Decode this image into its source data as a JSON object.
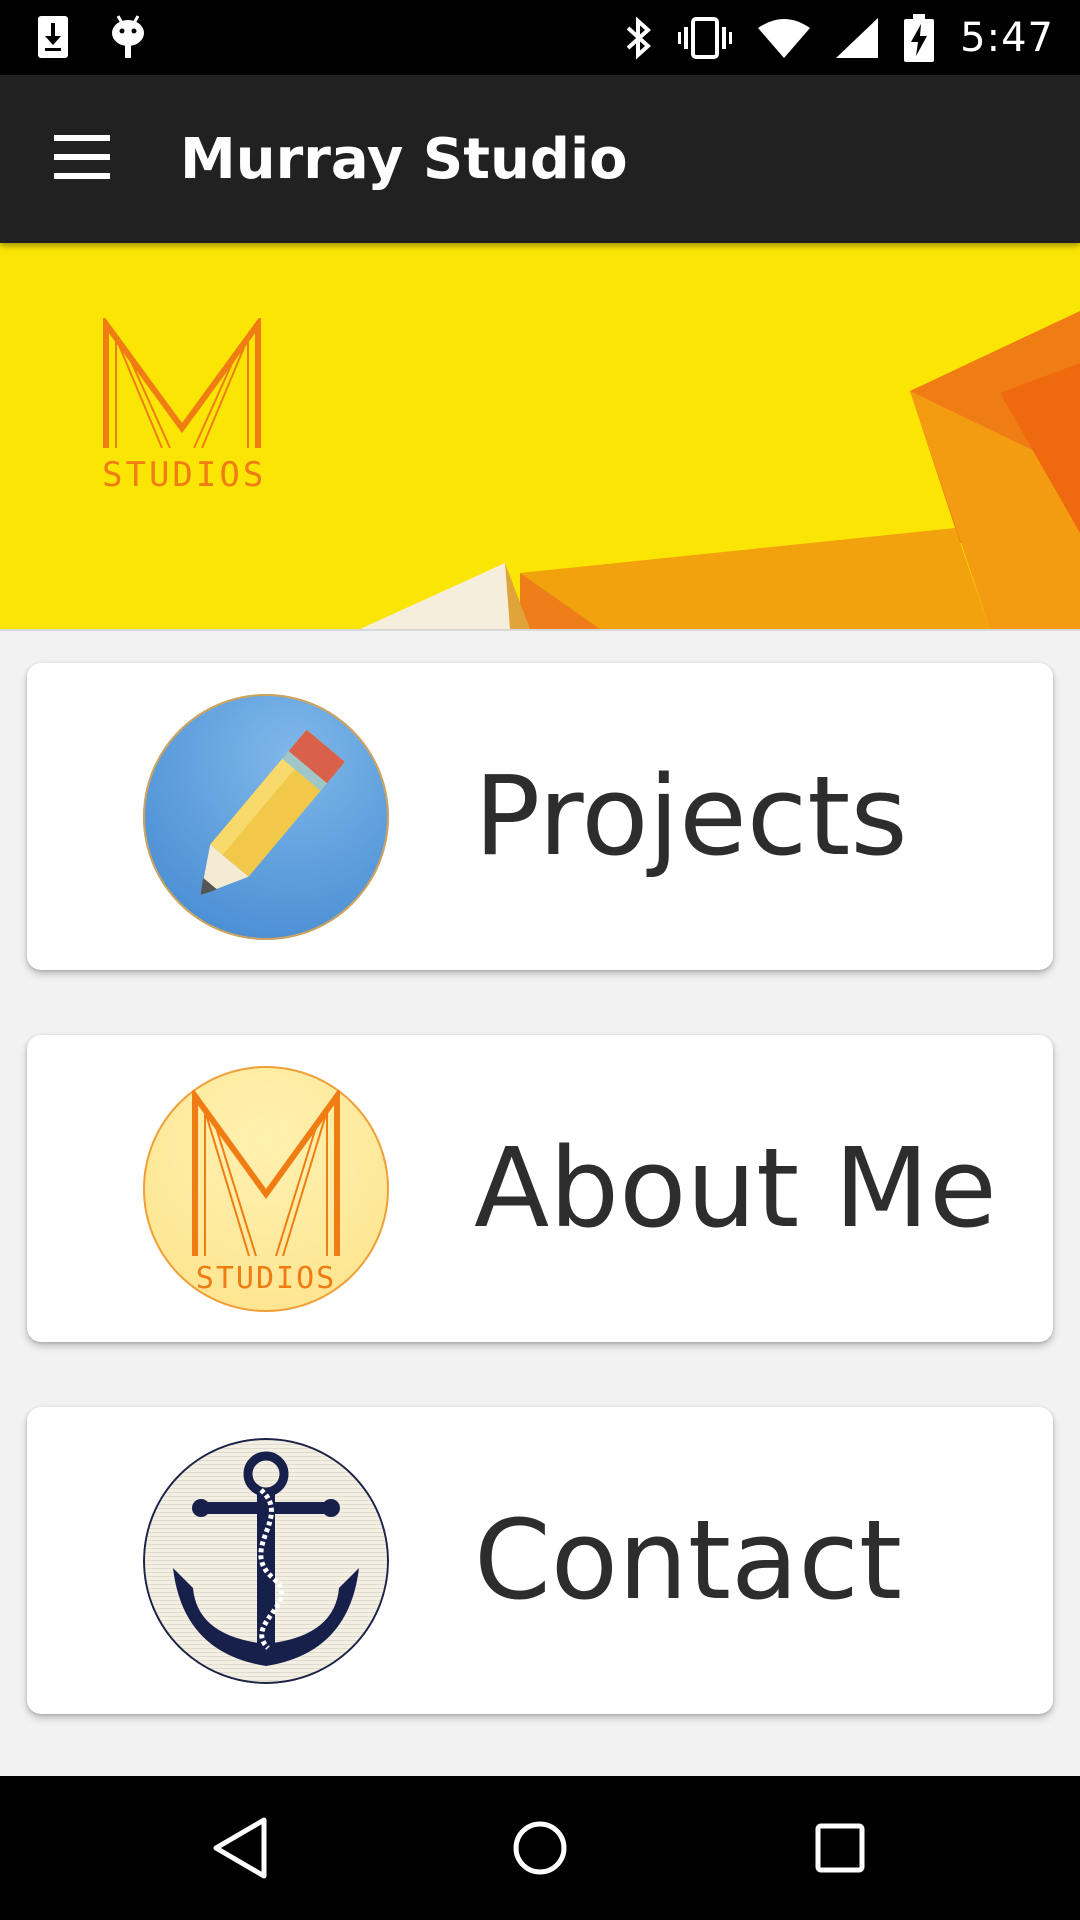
{
  "status_bar": {
    "time": "5:47",
    "left_icons": [
      "download-icon",
      "android-icon"
    ],
    "right_icons": [
      "bluetooth-icon",
      "vibrate-icon",
      "wifi-icon",
      "signal-icon",
      "battery-charging-icon"
    ]
  },
  "toolbar": {
    "title": "Murray Studio",
    "menu_icon": "hamburger-menu-icon"
  },
  "banner": {
    "logo_text": "STUDIOS",
    "colors": {
      "background": "#fbe505",
      "accent_orange": "#f07c14",
      "deep_orange": "#ef6a0f"
    }
  },
  "menu": {
    "items": [
      {
        "label": "Projects",
        "icon": "pencil-icon"
      },
      {
        "label": "About Me",
        "icon": "studio-logo-icon"
      },
      {
        "label": "Contact",
        "icon": "anchor-icon"
      }
    ]
  },
  "navigation_bar": {
    "buttons": [
      "back-icon",
      "home-icon",
      "recents-icon"
    ]
  }
}
